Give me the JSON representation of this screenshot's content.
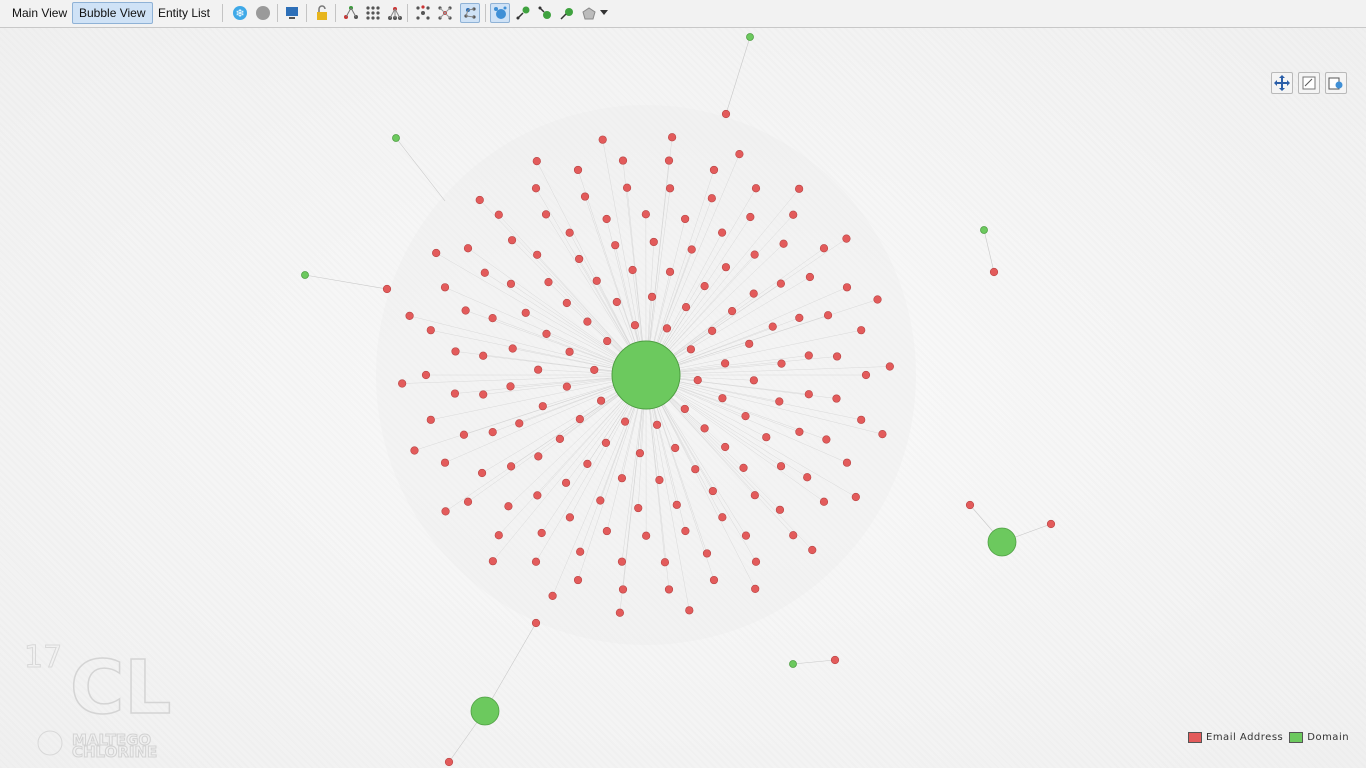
{
  "tabs": [
    {
      "label": "Main View",
      "active": false
    },
    {
      "label": "Bubble View",
      "active": true
    },
    {
      "label": "Entity List",
      "active": false
    }
  ],
  "toolbar_icons": [
    "freeze-layout-icon",
    "stop-layout-icon",
    "display-icon",
    "unlock-icon",
    "hierarchical-layout-icon",
    "block-layout-icon",
    "tree-layout-icon",
    "organic-layout-icon",
    "circular-layout-icon",
    "interactive-layout-icon",
    "bubble-sizing-icon",
    "select-children-icon",
    "add-parents-icon",
    "add-neighbours-icon",
    "select-by-type-icon",
    "dropdown-arrow-icon"
  ],
  "legend": [
    {
      "label": "Email Address",
      "color": "#e35b5b"
    },
    {
      "label": "Domain",
      "color": "#6cc95e"
    }
  ],
  "watermark": {
    "number": "17",
    "letters": "CL",
    "brand_line1": "MALTEGO",
    "brand_line2": "CHLORINE"
  },
  "colors": {
    "email": "#e35b5b",
    "domain": "#6cc95e",
    "edge": "#c8c8c8"
  },
  "graph": {
    "hub": {
      "type": "Domain",
      "size": "large"
    },
    "emails_linked_to_hub": 180,
    "other_domains": 7
  }
}
